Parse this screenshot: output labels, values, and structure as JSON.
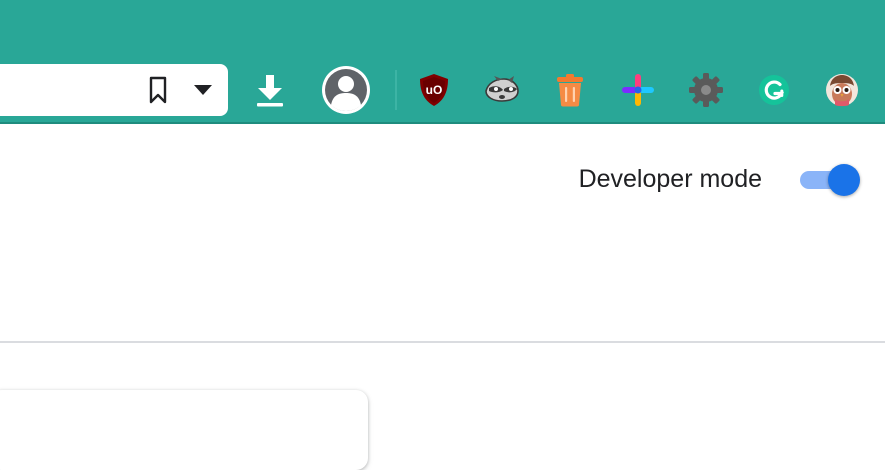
{
  "toolbar": {
    "background_color": "#29a797",
    "omnibox": {
      "bookmark_icon": "bookmark-outline-icon",
      "dropdown_icon": "caret-down-icon"
    },
    "download_icon": "download-icon",
    "profile_icon": "profile-avatar-icon",
    "extensions": [
      {
        "name": "ublock-origin-icon",
        "color": "#800000"
      },
      {
        "name": "raccoon-icon",
        "color": "#555555"
      },
      {
        "name": "trash-can-icon",
        "color": "#f37a2f"
      },
      {
        "name": "colorful-cross-icon",
        "color": "#ff3d7f"
      },
      {
        "name": "gear-icon",
        "color": "#5a5a5a"
      },
      {
        "name": "grammarly-icon",
        "color": "#15c39a"
      },
      {
        "name": "owl-avatar-icon",
        "color": "#c97a5a"
      }
    ]
  },
  "extensions_page": {
    "developer_mode_label": "Developer mode",
    "developer_mode_enabled": true,
    "toggle_color": "#1a73e8"
  }
}
